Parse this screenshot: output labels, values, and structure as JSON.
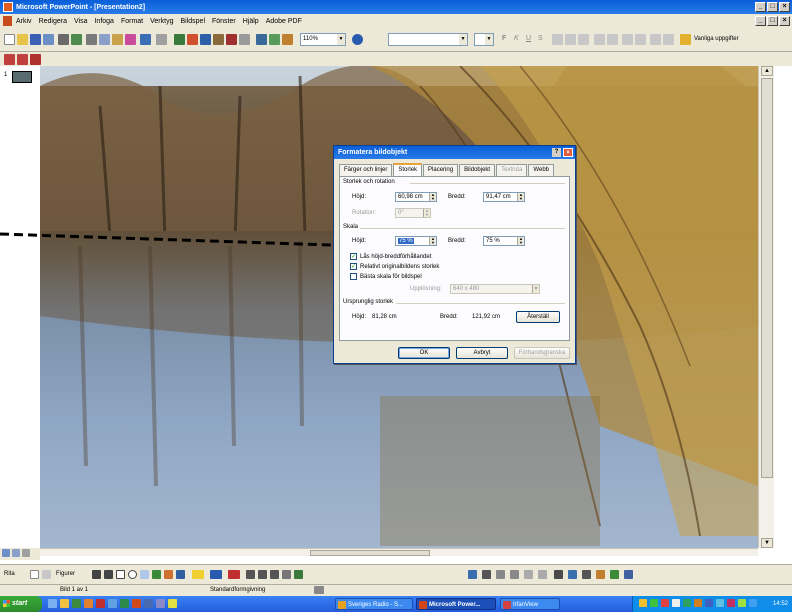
{
  "window": {
    "title": "Microsoft PowerPoint - [Presentation2]",
    "controls": [
      "_",
      "□",
      "×"
    ]
  },
  "menubar": {
    "items": [
      "Arkiv",
      "Redigera",
      "Visa",
      "Infoga",
      "Format",
      "Verktyg",
      "Bildspel",
      "Fönster",
      "Hjälp",
      "Adobe PDF"
    ]
  },
  "toolbar": {
    "zoom": "110%",
    "font_combo": "",
    "size_combo": "",
    "help_label": "Vanliga uppgifter",
    "bold": "F",
    "italic": "K",
    "underline": "U",
    "shadow": "S"
  },
  "slidepane": {
    "slide_number": "1"
  },
  "dialog": {
    "title": "Formatera bildobjekt",
    "help": "?",
    "close": "×",
    "tabs": [
      {
        "label": "Färger och linjer",
        "state": "normal"
      },
      {
        "label": "Storlek",
        "state": "active"
      },
      {
        "label": "Placering",
        "state": "normal"
      },
      {
        "label": "Bildobjekt",
        "state": "normal"
      },
      {
        "label": "Textruta",
        "state": "disabled"
      },
      {
        "label": "Webb",
        "state": "normal"
      }
    ],
    "size_section": "Storlek och rotation",
    "height_label": "Höjd:",
    "height_value": "60,98 cm",
    "width_label": "Bredd:",
    "width_value": "91,47 cm",
    "rotation_label": "Rotation:",
    "rotation_value": "0°",
    "scale_section": "Skala",
    "scale_height_label": "Höjd:",
    "scale_height_value": "75 %",
    "scale_width_label": "Bredd:",
    "scale_width_value": "75 %",
    "lock_ratio_label": "Lås höjd-breddförhållandet",
    "lock_ratio_checked": true,
    "relative_label": "Relativt originalbildens storlek",
    "relative_checked": true,
    "best_scale_label": "Bästa skala för bildspel",
    "best_scale_checked": false,
    "resolution_label": "Upplösning:",
    "resolution_value": "640 x 480",
    "original_section": "Ursprunglig storlek",
    "orig_height_label": "Höjd:",
    "orig_height_value": "81,28 cm",
    "orig_width_label": "Bredd:",
    "orig_width_value": "121,92 cm",
    "reset_button": "Återställ",
    "ok_button": "OK",
    "cancel_button": "Avbryt",
    "preview_button": "Förhandsgranska"
  },
  "drawbar": {
    "draw_label": "Rita",
    "autoshapes_label": "Figurer"
  },
  "statusbar": {
    "slide_info": "Bild 1 av 1",
    "design": "Standardformgivning"
  },
  "taskbar": {
    "start_label": "start",
    "tasks": [
      {
        "label": "Sveriges Radio - S...",
        "color": "#e8a020"
      },
      {
        "label": "Microsoft Power...",
        "color": "#d2461c",
        "active": true
      },
      {
        "label": "IrfanView",
        "color": "#d24040"
      }
    ],
    "clock": "14:52"
  },
  "colors": {
    "titlebar": "#0a5fd8",
    "chrome": "#ece9d8",
    "taskbar": "#245ddb",
    "start": "#2b8a2b"
  }
}
